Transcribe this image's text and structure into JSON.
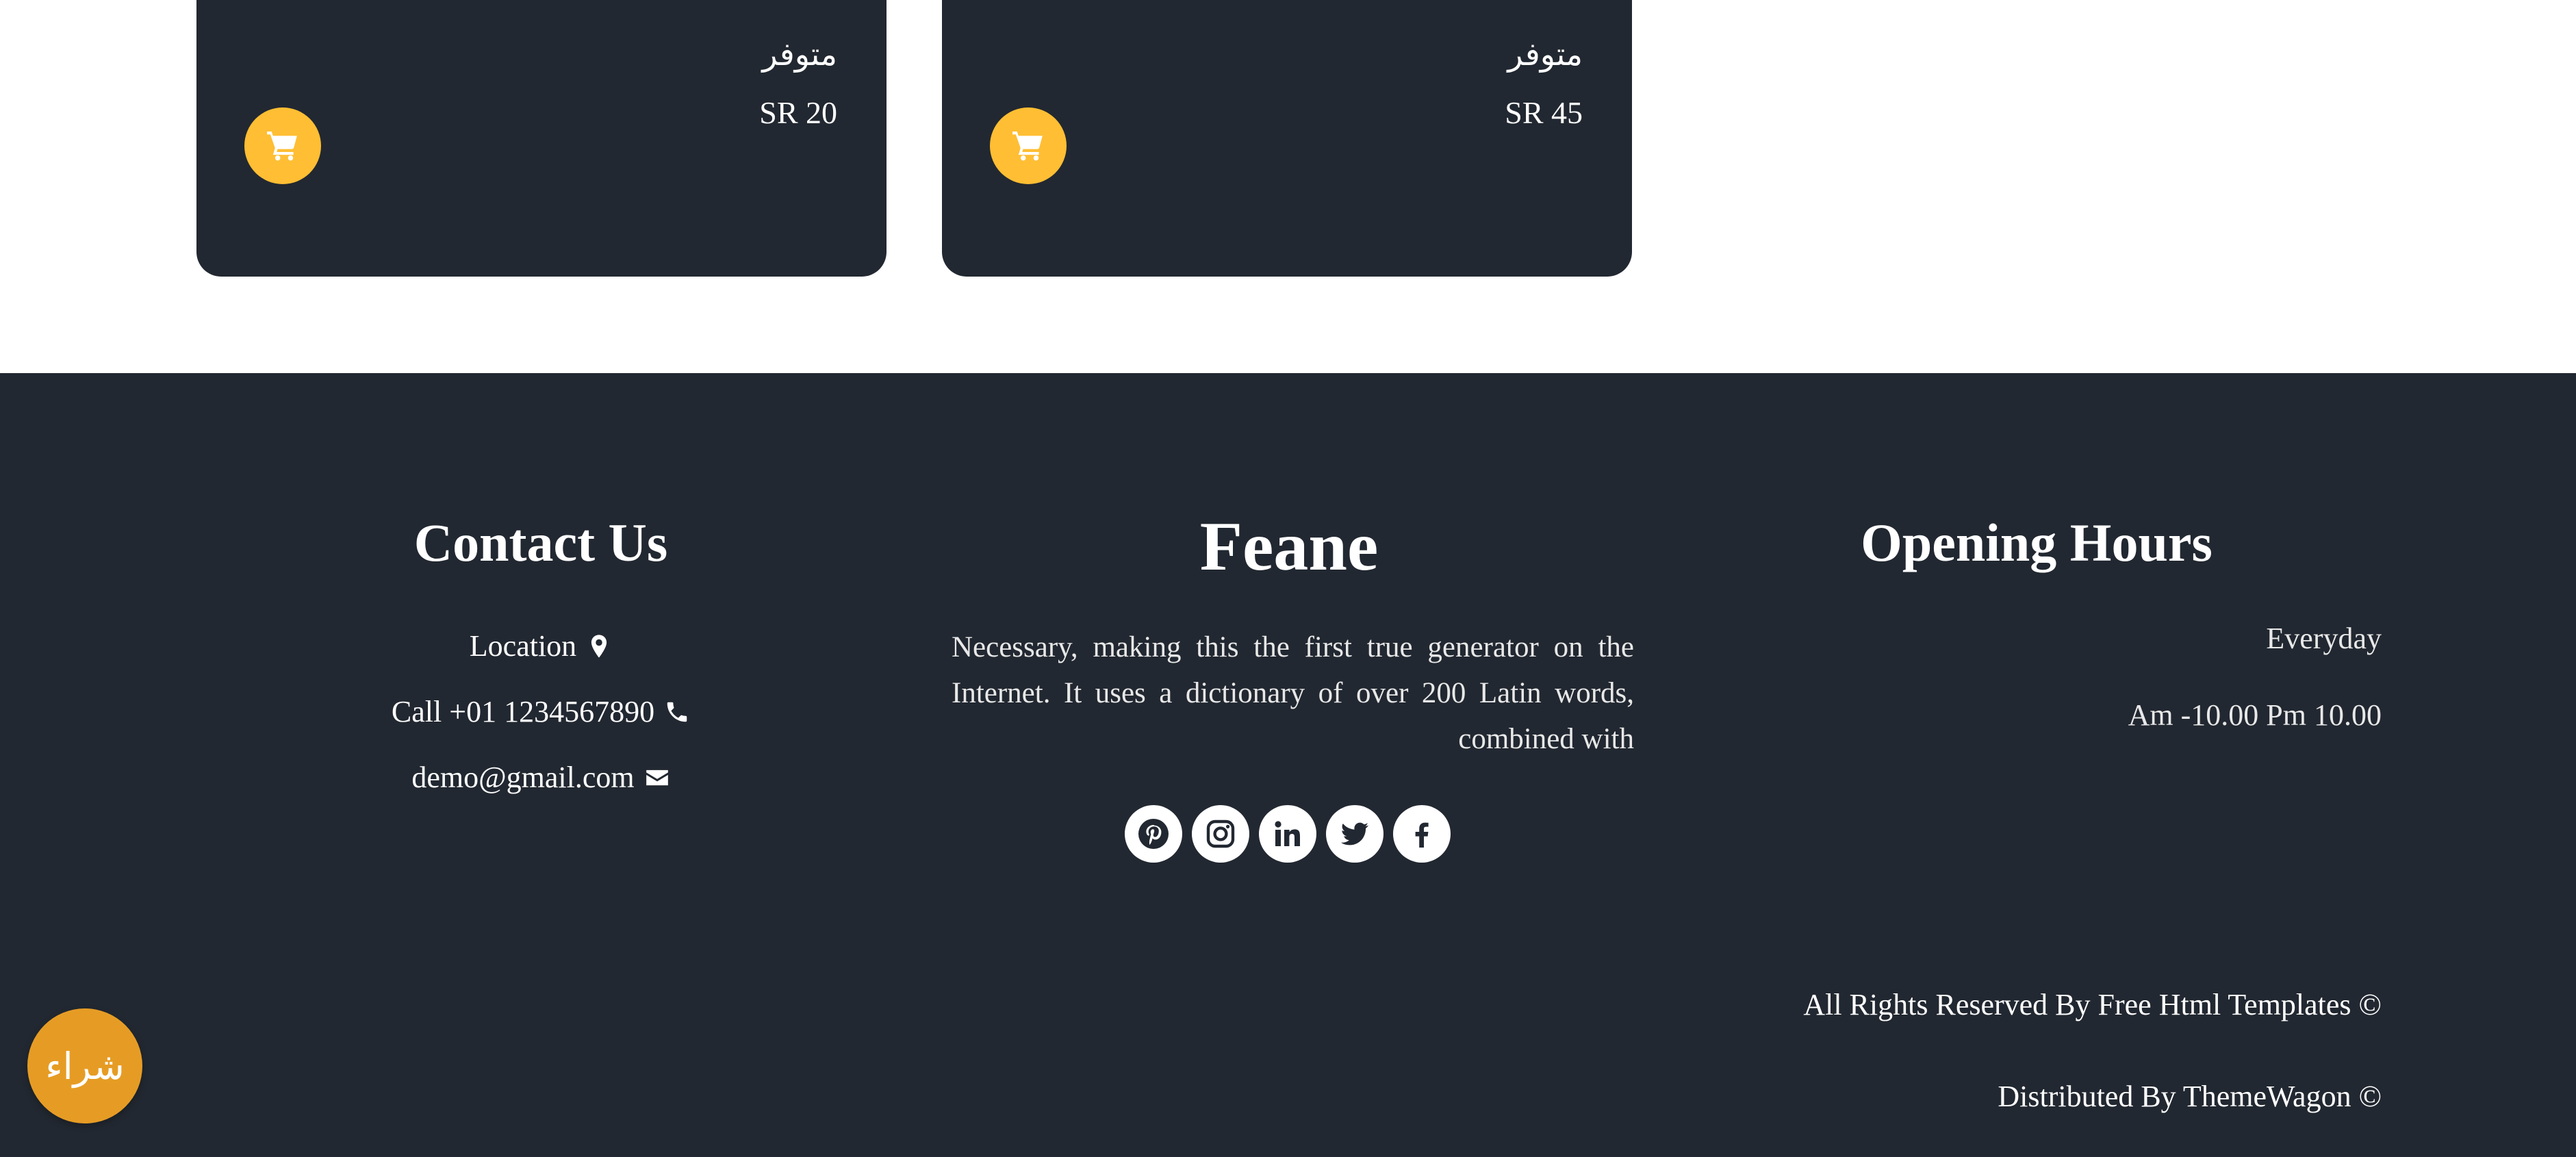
{
  "products": [
    {
      "status": "متوفر",
      "price": "SR 20",
      "cart_icon": "cart-icon"
    },
    {
      "status": "متوفر",
      "price": "SR 45",
      "cart_icon": "cart-icon"
    }
  ],
  "footer": {
    "contact": {
      "title": "Contact Us",
      "location": "Location",
      "call": "Call +01 1234567890",
      "email": "demo@gmail.com"
    },
    "brand": {
      "title": "Feane",
      "description": "Necessary, making this the first true generator on the Internet. It uses a dictionary of over 200 Latin words, combined with",
      "social": [
        "pinterest-icon",
        "instagram-icon",
        "linkedin-icon",
        "twitter-icon",
        "facebook-icon"
      ]
    },
    "hours": {
      "title": "Opening Hours",
      "day": "Everyday",
      "time": "Am -10.00 Pm 10.00"
    },
    "copyright": {
      "rights": "All Rights Reserved By Free Html Templates ©",
      "distributed": "Distributed By ThemeWagon ©"
    }
  },
  "buy_button": {
    "label": "شراء"
  },
  "colors": {
    "dark": "#222831",
    "accent": "#ffbe33",
    "fab": "#e69c24",
    "white": "#ffffff"
  }
}
